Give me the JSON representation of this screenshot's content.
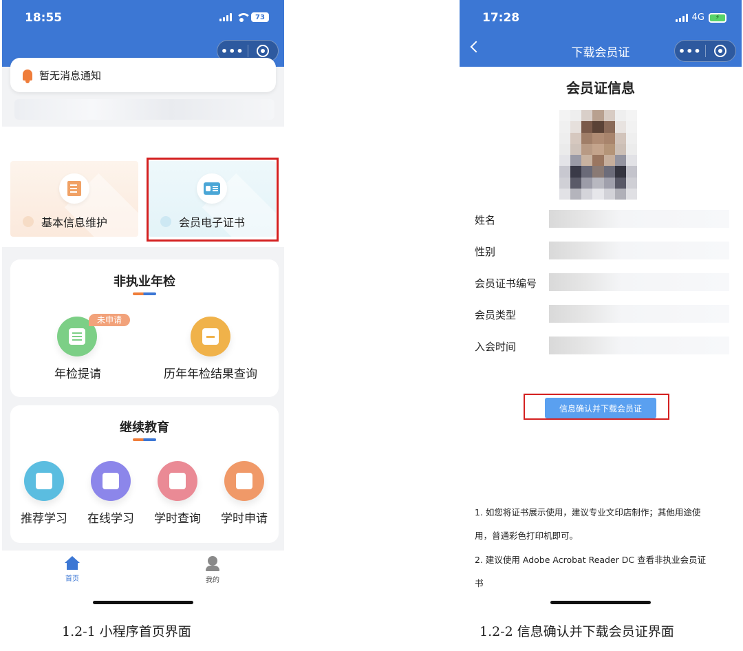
{
  "left_phone": {
    "status_time": "18:55",
    "battery": "73",
    "notice": "暂无消息通知",
    "tiles": [
      {
        "label": "基本信息维护"
      },
      {
        "label": "会员电子证书"
      }
    ],
    "annual_check": {
      "title": "非执业年检",
      "items": [
        {
          "label": "年检提请",
          "badge": "未申请"
        },
        {
          "label": "历年年检结果查询"
        }
      ]
    },
    "education": {
      "title": "继续教育",
      "items": [
        {
          "label": "推荐学习"
        },
        {
          "label": "在线学习"
        },
        {
          "label": "学时查询"
        },
        {
          "label": "学时申请"
        }
      ]
    },
    "tabbar": [
      {
        "label": "首页"
      },
      {
        "label": "我的"
      }
    ]
  },
  "right_phone": {
    "status_time": "17:28",
    "network": "4G",
    "nav_title": "下载会员证",
    "info_title": "会员证信息",
    "fields": [
      {
        "label": "姓名"
      },
      {
        "label": "性别"
      },
      {
        "label": "会员证书编号"
      },
      {
        "label": "会员类型"
      },
      {
        "label": "入会时间"
      }
    ],
    "confirm_button": "信息确认并下载会员证",
    "notes": [
      "1. 如您将证书展示使用，建议专业文印店制作；其他用途使",
      "用，普通彩色打印机即可。",
      "2. 建议使用 Adobe Acrobat Reader DC 查看非执业会员证",
      "书"
    ]
  },
  "captions": {
    "left": "1.2-1  小程序首页界面",
    "right": "1.2-2  信息确认并下载会员证界面"
  },
  "colors": {
    "brand_blue": "#3c77d4",
    "highlight_red": "#d42020",
    "button_blue": "#5aa0f0"
  }
}
